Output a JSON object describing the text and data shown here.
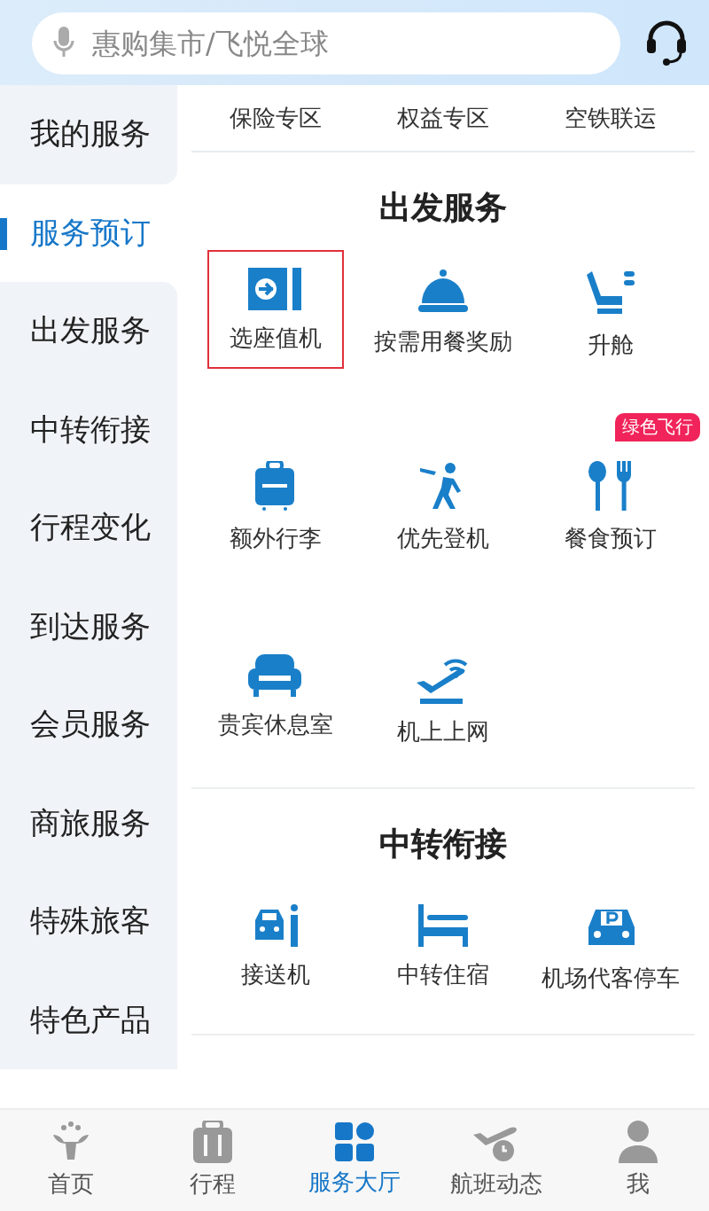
{
  "search": {
    "placeholder": "惠购集市/飞悦全球"
  },
  "sidebar": {
    "items": [
      {
        "label": "我的服务",
        "selected": false,
        "kind": "top"
      },
      {
        "label": "服务预订",
        "selected": true,
        "kind": "top"
      },
      {
        "label": "出发服务",
        "selected": false,
        "kind": "sub"
      },
      {
        "label": "中转衔接",
        "selected": false,
        "kind": "sub"
      },
      {
        "label": "行程变化",
        "selected": false,
        "kind": "sub"
      },
      {
        "label": "到达服务",
        "selected": false,
        "kind": "sub"
      },
      {
        "label": "会员服务",
        "selected": false,
        "kind": "sub"
      },
      {
        "label": "商旅服务",
        "selected": false,
        "kind": "sub"
      },
      {
        "label": "特殊旅客",
        "selected": false,
        "kind": "sub"
      },
      {
        "label": "特色产品",
        "selected": false,
        "kind": "sub"
      }
    ]
  },
  "top_links": [
    "保险专区",
    "权益专区",
    "空铁联运"
  ],
  "sections": [
    {
      "title": "出发服务",
      "items": [
        {
          "label": "选座值机",
          "selected": true
        },
        {
          "label": "按需用餐奖励",
          "selected": false
        },
        {
          "label": "升舱",
          "selected": false
        },
        {
          "label": "额外行李",
          "selected": false
        },
        {
          "label": "优先登机",
          "selected": false
        },
        {
          "label": "餐食预订",
          "selected": false,
          "badge": "绿色飞行"
        },
        {
          "label": "贵宾休息室",
          "selected": false
        },
        {
          "label": "机上上网",
          "selected": false
        }
      ]
    },
    {
      "title": "中转衔接",
      "items": [
        {
          "label": "接送机",
          "selected": false
        },
        {
          "label": "中转住宿",
          "selected": false
        },
        {
          "label": "机场代客停车",
          "selected": false
        }
      ]
    }
  ],
  "tab_bar": [
    {
      "label": "首页",
      "selected": false
    },
    {
      "label": "行程",
      "selected": false
    },
    {
      "label": "服务大厅",
      "selected": true
    },
    {
      "label": "航班动态",
      "selected": false
    },
    {
      "label": "我",
      "selected": false
    }
  ]
}
